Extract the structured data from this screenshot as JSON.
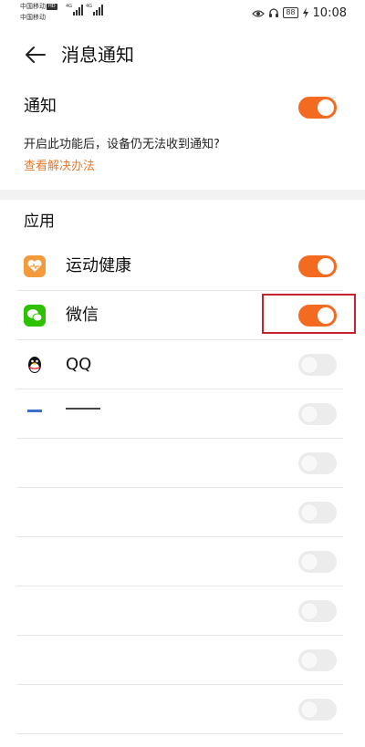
{
  "status_bar": {
    "carrier1": "中国移动",
    "carrier2": "中国移动",
    "hd": "HD",
    "net1": "4G",
    "net2": "4G",
    "battery": "88",
    "time": "10:08"
  },
  "header": {
    "title": "消息通知"
  },
  "notification": {
    "label": "通知",
    "enabled": true,
    "hint": "开启此功能后，设备仍无法收到通知?",
    "link": "查看解决办法"
  },
  "apps_section": {
    "title": "应用",
    "items": [
      {
        "name": "运动健康",
        "icon": "health-app-icon",
        "enabled": true,
        "color": "#f39a3a"
      },
      {
        "name": "微信",
        "icon": "wechat-app-icon",
        "enabled": true,
        "color": "#2dc100"
      },
      {
        "name": "QQ",
        "icon": "qq-penguin-icon",
        "enabled": false,
        "color": "#111111"
      },
      {
        "name": "",
        "icon": "app-icon",
        "enabled": false
      },
      {
        "name": "",
        "icon": "",
        "enabled": false
      },
      {
        "name": "",
        "icon": "",
        "enabled": false
      },
      {
        "name": "",
        "icon": "",
        "enabled": false
      },
      {
        "name": "",
        "icon": "",
        "enabled": false
      },
      {
        "name": "",
        "icon": "",
        "enabled": false
      },
      {
        "name": "",
        "icon": "",
        "enabled": false
      }
    ]
  },
  "colors": {
    "accent": "#f26b21",
    "link": "#e6782c",
    "highlight": "#c8232c"
  }
}
